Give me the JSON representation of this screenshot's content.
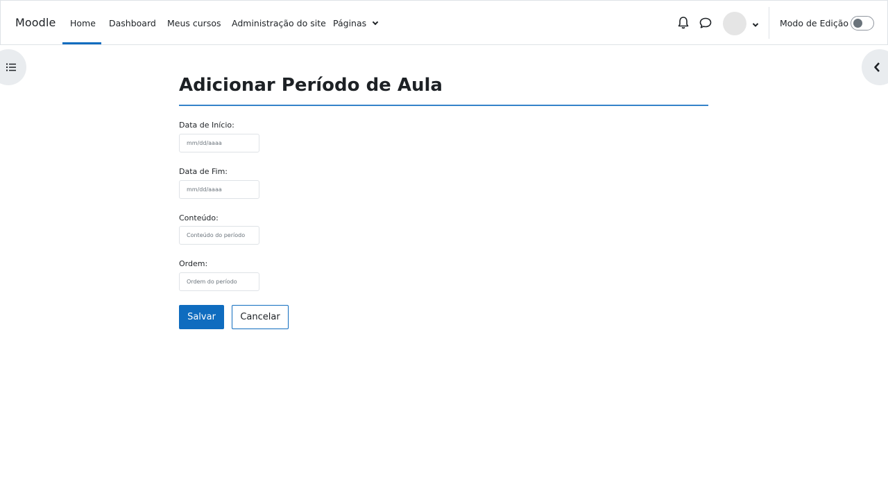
{
  "navbar": {
    "brand": "Moodle",
    "items": [
      {
        "label": "Home",
        "active": true
      },
      {
        "label": "Dashboard"
      },
      {
        "label": "Meus cursos"
      },
      {
        "label": "Administração do site"
      },
      {
        "label": "Páginas"
      }
    ],
    "edit_mode_label": "Modo de Edição",
    "edit_mode_on": false,
    "icons": [
      "bell-icon",
      "chat-icon",
      "chevron-down-icon"
    ]
  },
  "drawers": {
    "left_icon": "list-icon",
    "right_icon": "chevron-left-icon"
  },
  "page": {
    "title": "Adicionar Período de Aula"
  },
  "form": {
    "start_date": {
      "label": "Data de Início:",
      "placeholder": "mm/dd/aaaa",
      "value": ""
    },
    "end_date": {
      "label": "Data de Fim:",
      "placeholder": "mm/dd/aaaa",
      "value": ""
    },
    "content": {
      "label": "Conteúdo:",
      "placeholder": "Conteúdo do período",
      "value": ""
    },
    "order": {
      "label": "Ordem:",
      "placeholder": "Ordem do período",
      "value": ""
    },
    "save_label": "Salvar",
    "cancel_label": "Cancelar"
  },
  "colors": {
    "primary": "#0f6cbf",
    "text": "#1d2125",
    "border": "#dee2e6",
    "drawer_bg": "#e9ecef"
  }
}
